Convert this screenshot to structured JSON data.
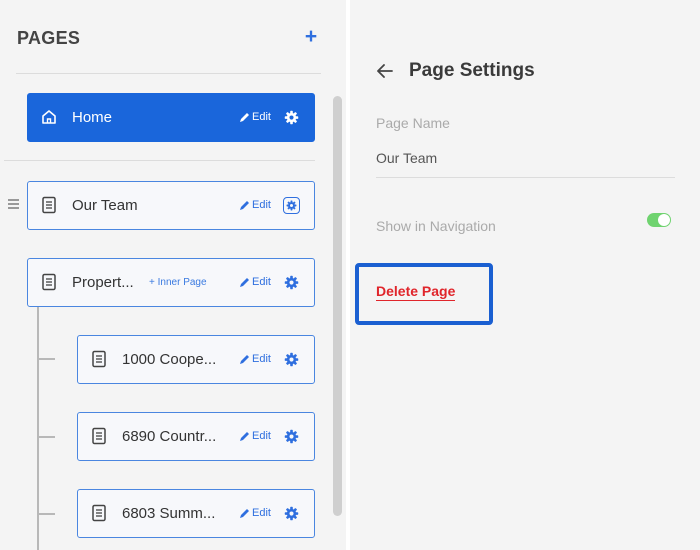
{
  "pages_panel": {
    "title": "PAGES",
    "add_icon": "plus-icon",
    "items": [
      {
        "label": "Home",
        "icon": "home-icon",
        "edit_label": "Edit",
        "active": true
      },
      {
        "label": "Our Team",
        "icon": "document-icon",
        "edit_label": "Edit",
        "active": false
      },
      {
        "label": "Propert...",
        "icon": "document-icon",
        "inner_page_label": "+ Inner Page",
        "edit_label": "Edit",
        "active": false
      },
      {
        "label": "1000 Coope...",
        "icon": "document-icon",
        "edit_label": "Edit",
        "active": false
      },
      {
        "label": "6890 Countr...",
        "icon": "document-icon",
        "edit_label": "Edit",
        "active": false
      },
      {
        "label": "6803 Summ...",
        "icon": "document-icon",
        "edit_label": "Edit",
        "active": false
      }
    ]
  },
  "settings_panel": {
    "title": "Page Settings",
    "page_name_label": "Page Name",
    "page_name_value": "Our Team",
    "show_in_nav_label": "Show in Navigation",
    "show_in_nav_enabled": true,
    "delete_label": "Delete Page"
  },
  "colors": {
    "accent": "#1a66db",
    "link": "#2f6fdf",
    "danger": "#e0252b",
    "toggle_on": "#6fd36f"
  }
}
